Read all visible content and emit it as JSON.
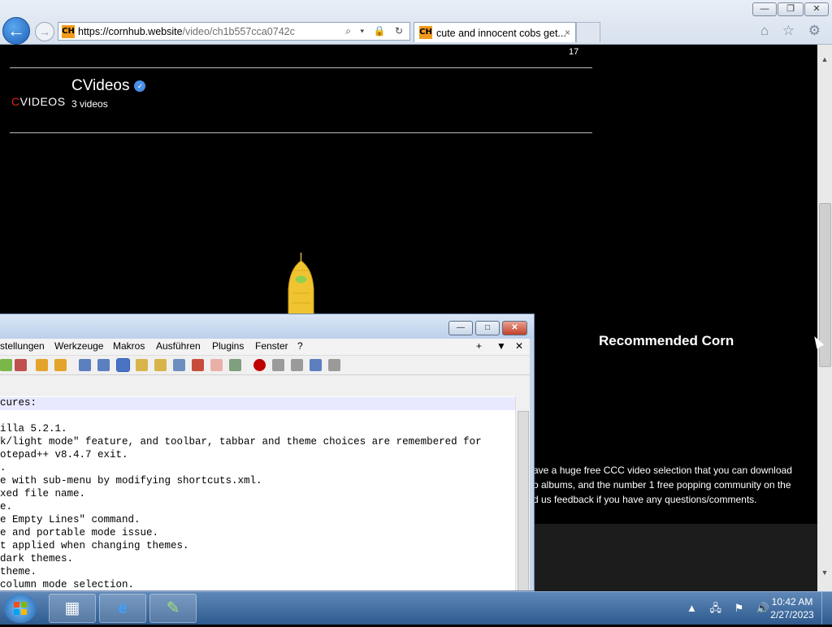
{
  "browser": {
    "url_host": "https://cornhub.website",
    "url_path": "/video/ch1b557cca0742c",
    "favicon_text": "CH",
    "tab_title": "cute and innocent cobs get...",
    "tab_close": "×",
    "back_glyph": "←",
    "forward_glyph": "→",
    "addr_icons": "⌕ ▾ 🔒 ↻",
    "toolbar_icons": "⌂ ☆ ⚙",
    "window_buttons": {
      "minimize": "—",
      "restore": "❐",
      "close": "✕"
    }
  },
  "page": {
    "top_count": "17",
    "channel": {
      "logo_red": "C",
      "logo_rest": "VIDEOS",
      "name": "CVideos",
      "verified": "✓",
      "count": "3 videos"
    },
    "recommended_title": "Recommended Corn",
    "description_lines": [
      "ave a huge free CCC video selection that you can download",
      "o albums, and the number 1 free popping community on the",
      "d us feedback if you have any questions/comments."
    ]
  },
  "notepad": {
    "menu": [
      "stellungen",
      "Werkzeuge",
      "Makros",
      "Ausführen",
      "Plugins",
      "Fenster",
      "?"
    ],
    "menu_right": [
      "+",
      "▼",
      "✕"
    ],
    "window_buttons": {
      "minimize": "—",
      "maximize": "□",
      "close": "✕"
    },
    "lines": [
      "cures:",
      "",
      "illa 5.2.1.",
      "k/light mode\" feature, and toolbar, tabbar and theme choices are remembered for",
      "otepad++ v8.4.7 exit.",
      ".",
      "e with sub-menu by modifying shortcuts.xml.",
      "xed file name.",
      "e.",
      "e Empty Lines\" command.",
      "e and portable mode issue.",
      "t applied when changing themes.",
      "dark themes.",
      " theme.",
      " column mode selection."
    ]
  },
  "taskbar": {
    "time": "10:42 AM",
    "date": "2/27/2023",
    "tray_icons": "▲ 🖧 ⚑ 🔊"
  },
  "colors": {
    "accent_red": "#e1251b",
    "verified_blue": "#4a8fe6",
    "favicon_orange": "#f29b1d"
  }
}
